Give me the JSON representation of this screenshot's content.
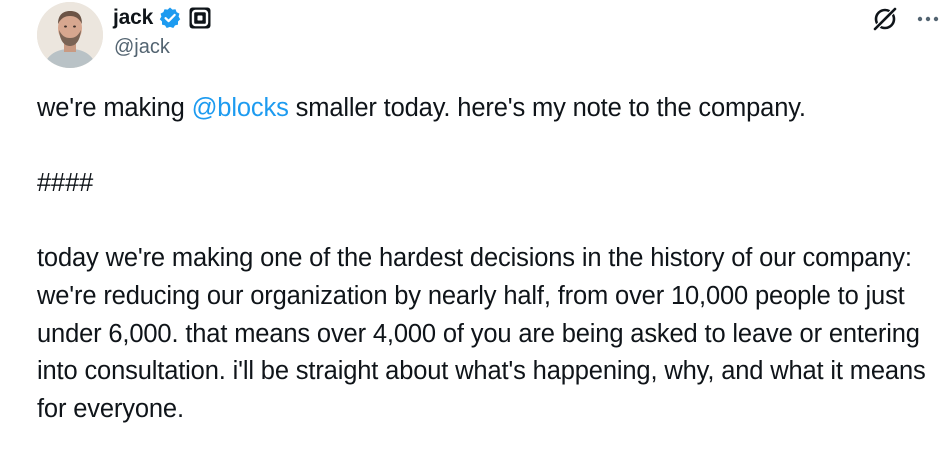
{
  "author": {
    "name": "jack",
    "handle": "@jack"
  },
  "icons": {
    "avatar": "profile-photo",
    "verified": "verified-badge-icon",
    "affiliate": "block-square-logo-icon",
    "grok": "grok-icon",
    "more": "more-options-icon"
  },
  "colors": {
    "text": "#0f1419",
    "secondary": "#536471",
    "link": "#1d9bf0",
    "verified": "#1d9bf0"
  },
  "tweet": {
    "line1_before": "we're making ",
    "line1_mention": "@blocks",
    "line1_after": " smaller today. here's my note to the company.",
    "separator": "####",
    "paragraph": "today we're making one of the hardest decisions in the history of our company: we're reducing our organization by nearly half, from over 10,000 people to just under 6,000. that means over 4,000 of you are being asked to leave or entering into consultation. i'll be straight about what's happening, why, and what it means for everyone."
  }
}
